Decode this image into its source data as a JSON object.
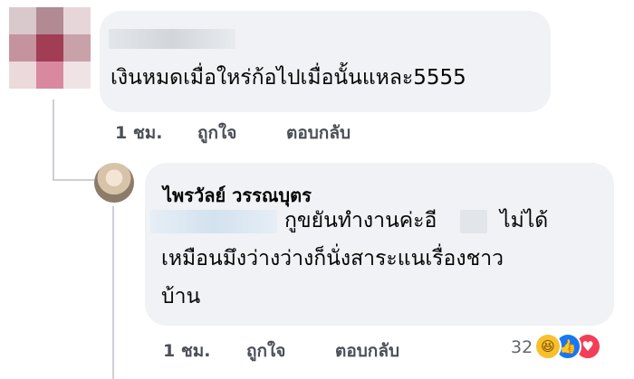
{
  "comment1": {
    "author_name_hidden": true,
    "text": "เงินหมดเมื่อใหร่ก้อไปเมื่อนั้นแหละ5555",
    "time": "1 ชม.",
    "like_label": "ถูกใจ",
    "reply_label": "ตอบกลับ",
    "avatar_colors": [
      "#d9c8cc",
      "#b28a93",
      "#e7d6d9",
      "#c4939d",
      "#a13d55",
      "#c8a1a9",
      "#ecd9dc",
      "#d889a0",
      "#efe3e6"
    ]
  },
  "reply": {
    "author_name": "ไพรวัลย์ วรรณบุตร",
    "line1": "กูขยันทำงานค่ะอี",
    "line1_after": "ไม่ได้",
    "line2": "เหมือนมึงว่างว่างก็นั่งสาระแนเรื่องชาว",
    "line3": "บ้าน",
    "time": "1 ชม.",
    "like_label": "ถูกใจ",
    "reply_label": "ตอบกลับ",
    "reaction_count": "32",
    "reactions": [
      "haha",
      "like",
      "love"
    ],
    "haha_glyph": "😆",
    "like_glyph": "👍",
    "love_glyph": "♥"
  }
}
